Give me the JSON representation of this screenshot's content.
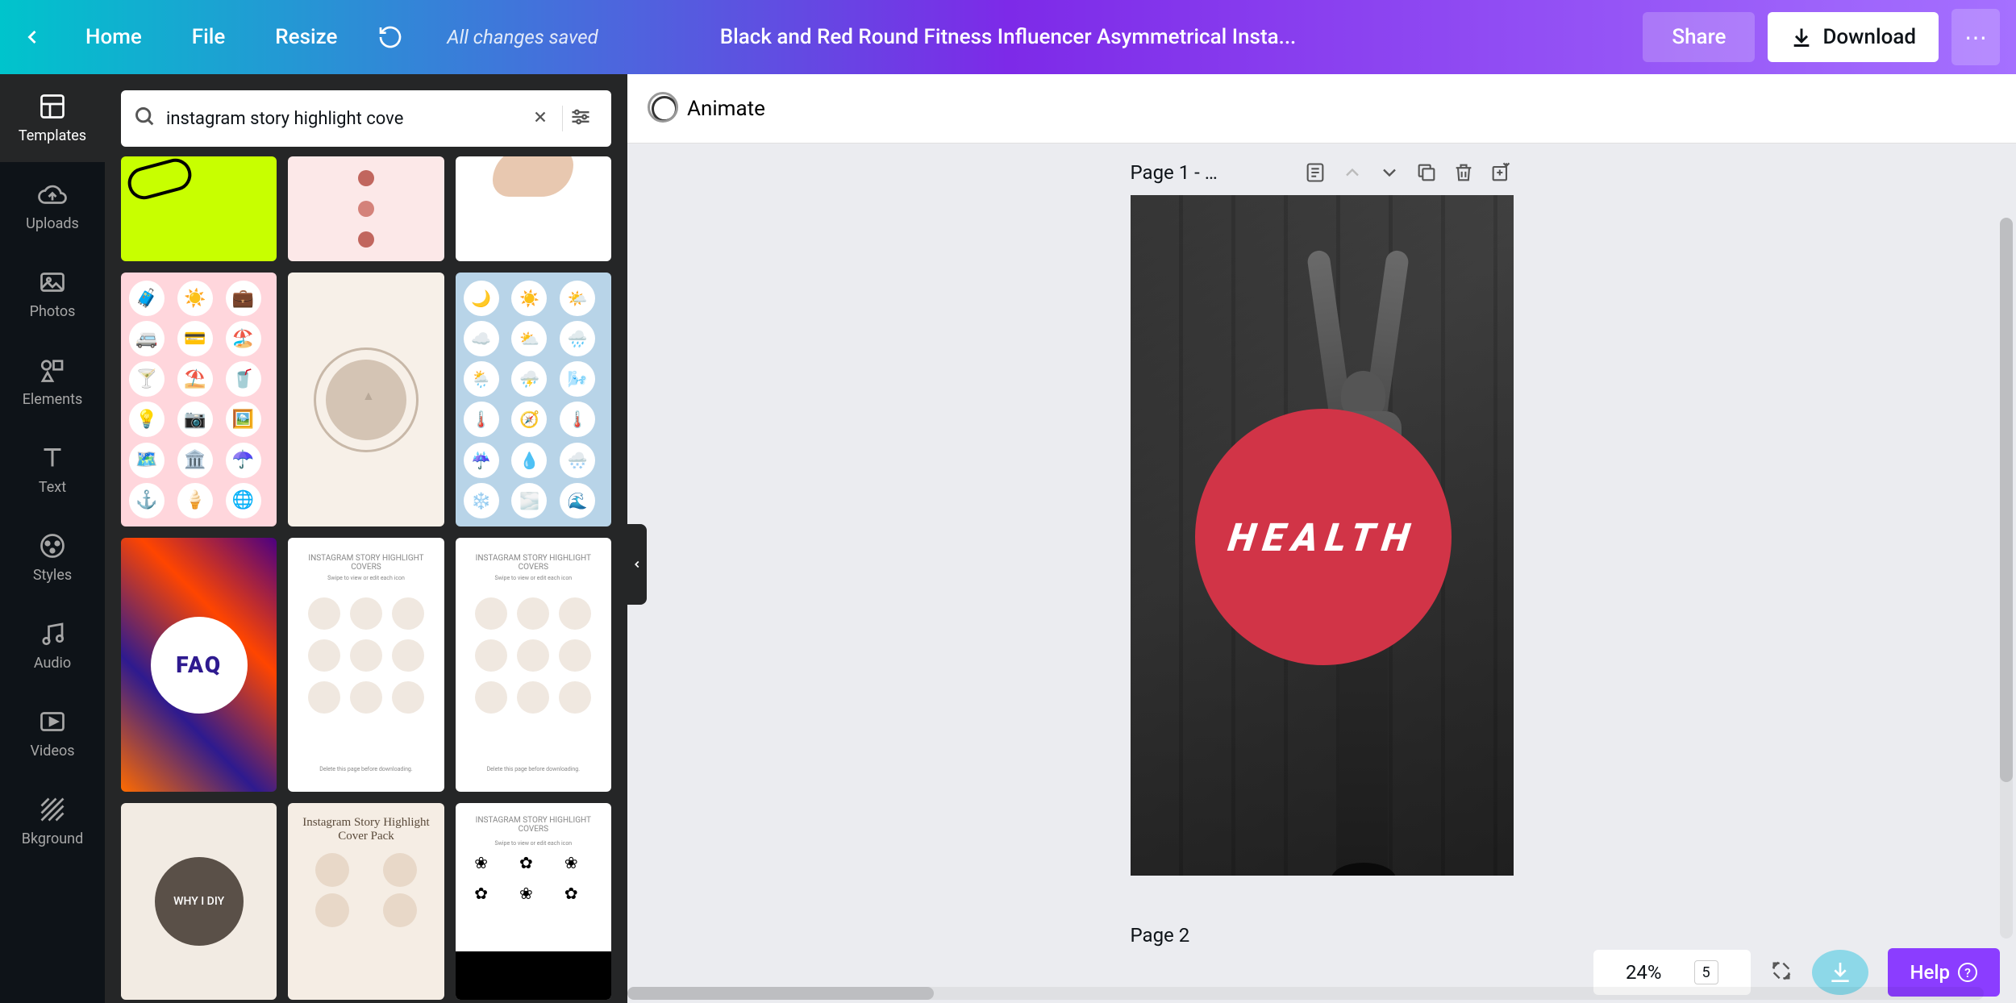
{
  "topbar": {
    "home": "Home",
    "file": "File",
    "resize": "Resize",
    "save_status": "All changes saved",
    "title": "Black and Red Round Fitness Influencer Asymmetrical Insta...",
    "share": "Share",
    "download": "Download"
  },
  "sidebar": {
    "items": [
      {
        "label": "Templates",
        "icon": "templates"
      },
      {
        "label": "Uploads",
        "icon": "uploads"
      },
      {
        "label": "Photos",
        "icon": "photos"
      },
      {
        "label": "Elements",
        "icon": "elements"
      },
      {
        "label": "Text",
        "icon": "text"
      },
      {
        "label": "Styles",
        "icon": "styles"
      },
      {
        "label": "Audio",
        "icon": "audio"
      },
      {
        "label": "Videos",
        "icon": "videos"
      },
      {
        "label": "Bkground",
        "icon": "background"
      }
    ]
  },
  "search": {
    "value": "instagram story highlight cove"
  },
  "templates": {
    "faq": "FAQ",
    "why_i_diy": "WHY I DIY",
    "pack_title": "Instagram Story Highlight Cover Pack",
    "leaf_cover_title": "INSTAGRAM STORY HIGHLIGHT COVERS",
    "leaf_cover_sub": "Swipe to view or edit each icon",
    "leaf_cover_footer": "Delete this page before downloading.",
    "travel_icons": [
      "🧳",
      "☀️",
      "💼",
      "🚐",
      "💳",
      "🏖️",
      "🍸",
      "⛱️",
      "🥤",
      "💡",
      "📷",
      "🖼️",
      "🗺️",
      "🏛️",
      "☂️",
      "⚓",
      "🍦",
      "🌐"
    ],
    "weather_icons": [
      "🌙",
      "☀️",
      "🌤️",
      "☁️",
      "⛅",
      "🌧️",
      "🌦️",
      "⛈️",
      "🌬️",
      "🌡️",
      "🧭",
      "🌡️",
      "☔",
      "💧",
      "🌨️",
      "❄️",
      "🌫️",
      "🌊"
    ]
  },
  "canvas": {
    "animate": "Animate",
    "page1_label": "Page 1 - …",
    "page2_label": "Page 2",
    "health_text": "HEALTH"
  },
  "bottombar": {
    "zoom": "24%",
    "page_count": "5",
    "help": "Help"
  }
}
